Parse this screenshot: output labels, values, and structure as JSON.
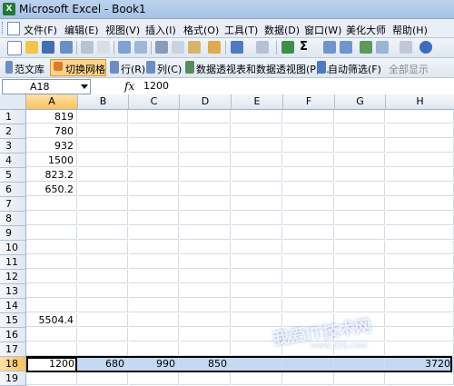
{
  "window": {
    "title": "Microsoft Excel - Book1"
  },
  "menu": [
    "文件(F)",
    "编辑(E)",
    "视图(V)",
    "插入(I)",
    "格式(O)",
    "工具(T)",
    "数据(D)",
    "窗口(W)",
    "美化大师",
    "帮助(H)"
  ],
  "toolbar2": {
    "template_lib": "范文库",
    "toggle_grid": "切换网格",
    "row": "行(R)",
    "col": "列(C)",
    "pivot": "数据透视表和数据透视图(P)...",
    "autofilter": "自动筛选(F)",
    "show_all": "全部显示"
  },
  "formula_bar": {
    "name_box": "A18",
    "fx": "fx",
    "content": "1200"
  },
  "columns": [
    "A",
    "B",
    "C",
    "D",
    "E",
    "F",
    "G",
    "H"
  ],
  "rows": [
    "1",
    "2",
    "3",
    "4",
    "5",
    "6",
    "7",
    "8",
    "9",
    "10",
    "11",
    "12",
    "13",
    "14",
    "15",
    "16",
    "17",
    "18",
    "19"
  ],
  "cells": {
    "A1": "819",
    "A2": "780",
    "A3": "932",
    "A4": "1500",
    "A5": "823.2",
    "A6": "650.2",
    "A15": "5504.4",
    "A18": "1200",
    "B18": "680",
    "C18": "990",
    "D18": "850",
    "H18": "3720"
  },
  "watermark": {
    "main": "我爱IT技术网",
    "sub": "www.52ij.com"
  }
}
